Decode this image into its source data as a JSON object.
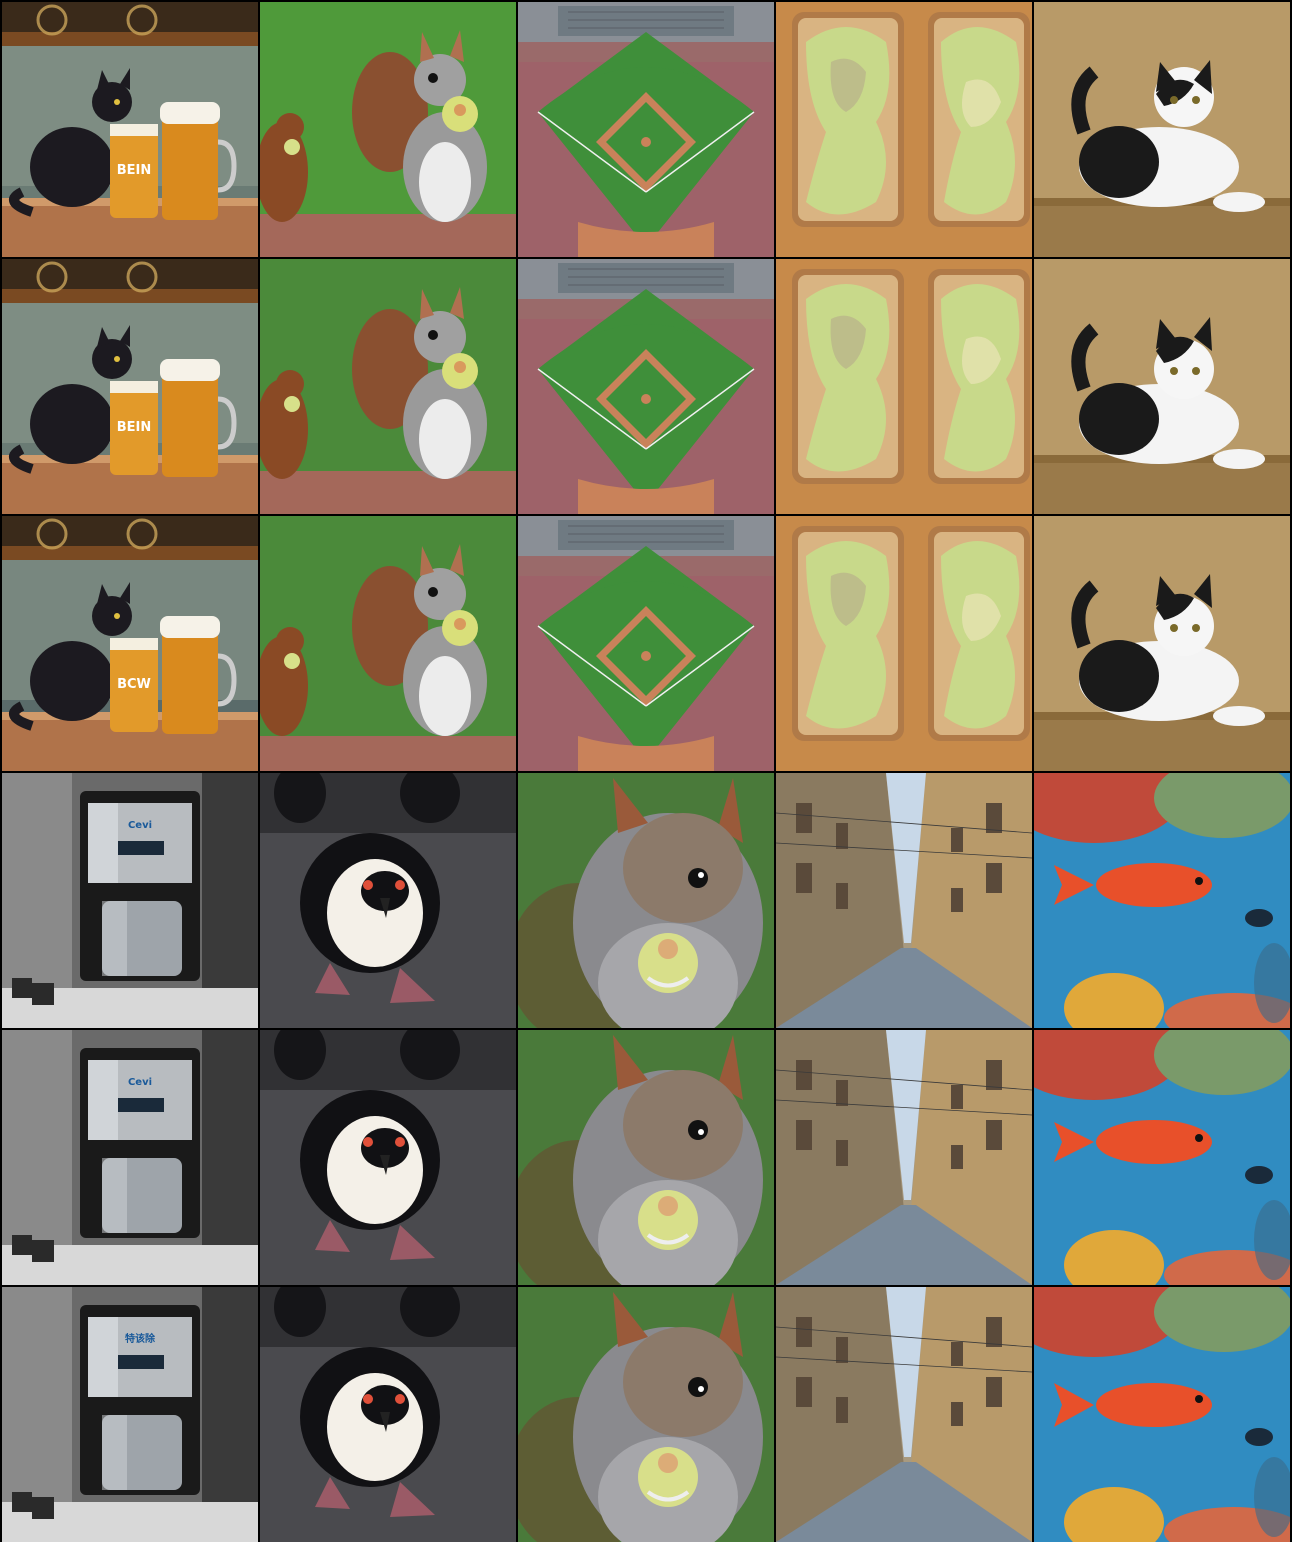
{
  "layout": {
    "columns": 5,
    "rows": 6
  },
  "columns": [
    {
      "subject": "black cat with beer mugs on bar counter",
      "icon": "cat-beer"
    },
    {
      "subject": "squirrel holding apple, with chipmunk",
      "icon": "squirrel-apple"
    },
    {
      "subject": "aerial view of baseball stadium",
      "icon": "baseball-stadium"
    },
    {
      "subject": "avocado toast on wooden board",
      "icon": "avocado-toast"
    },
    {
      "subject": "black and white cat on shelf",
      "icon": "cat-shelf"
    },
    {
      "subject": "stainless steel coffee maker",
      "icon": "coffee-maker"
    },
    {
      "subject": "penguin chick walking",
      "icon": "penguin"
    },
    {
      "subject": "close-up squirrel eating apple",
      "icon": "squirrel-closeup"
    },
    {
      "subject": "narrow cobblestone street",
      "icon": "street"
    },
    {
      "subject": "orange fish over coral reef",
      "icon": "fish-reef"
    }
  ],
  "mug_labels": [
    "BEIN",
    "BEIN",
    "BCW"
  ],
  "coffee_labels": [
    "Cevi",
    "Cevi",
    "特该除"
  ],
  "colors": {
    "separator": "#000000",
    "grass": "#3f8f3a",
    "avocado": "#c8d98a",
    "ocean": "#2a7fb5"
  }
}
